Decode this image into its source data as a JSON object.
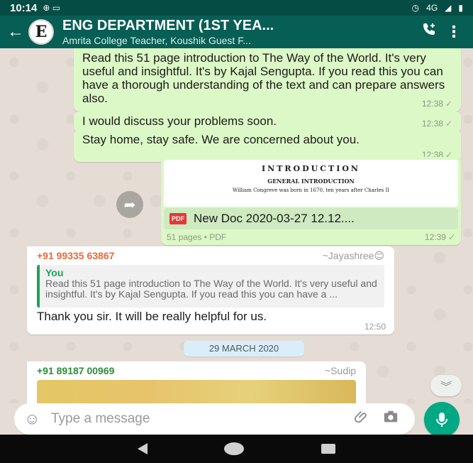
{
  "status_bar": {
    "time": "10:14",
    "network": "4G"
  },
  "header": {
    "avatar_letter": "E",
    "title": "ENG DEPARTMENT (1ST YEA...",
    "subtitle": "Amrita College Teacher, Koushik Guest F..."
  },
  "messages": [
    {
      "type": "outgoing",
      "text": "Read this 51 page introduction to The Way of the World. It's very useful and insightful. It's by Kajal Sengupta. If you read this you can have a thorough understanding of the text and can prepare answers also.",
      "time": "12:38"
    },
    {
      "type": "outgoing",
      "text": "I would discuss your problems soon.",
      "time": "12:38"
    },
    {
      "type": "outgoing",
      "text": "Stay home, stay safe. We are concerned about you.",
      "time": "12:38"
    }
  ],
  "document": {
    "preview_heading": "INTRODUCTION",
    "preview_subheading": "GENERAL INTRODUCTION",
    "preview_line": "William Congreve was born in 1670, ten years after Charles II",
    "file_icon": "PDF",
    "file_name": "New Doc 2020-03-27 12.12....",
    "info": "51 pages • PDF",
    "time": "12:39"
  },
  "reply_message": {
    "sender_phone": "+91 99335 63867",
    "sender_name": "~Jayashree😊",
    "quote_author": "You",
    "quote_text": "Read this 51 page introduction to The Way of the World. It's very useful and insightful. It's by Kajal Sengupta. If you read this you can have a ...",
    "text": "Thank you sir. It will be really helpful for us.",
    "time": "12:50"
  },
  "date_divider": "29 MARCH 2020",
  "image_message": {
    "sender_phone": "+91 89187 00969",
    "sender_name": "~Sudip"
  },
  "composer": {
    "placeholder": "Type a message"
  },
  "colors": {
    "header": "#075e54",
    "outgoing_bubble": "#dcf8c6",
    "mic_button": "#00a884"
  }
}
